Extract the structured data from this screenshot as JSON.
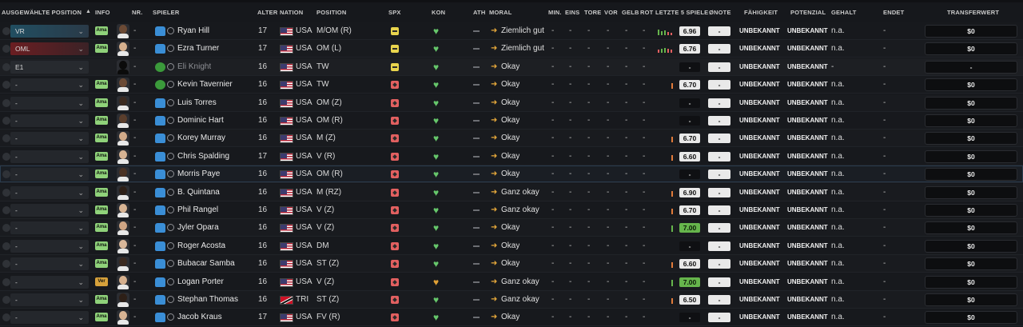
{
  "columns": {
    "position_select": "AUSGEWÄHLTE POSITION",
    "sort_indicator": "▲",
    "info": "INFO",
    "nr": "NR.",
    "player": "SPIELER",
    "age": "ALTER",
    "nation": "NATION",
    "position": "POSITION",
    "spx": "SPX",
    "kon": "KON",
    "ath": "ATH",
    "morale": "MORAL",
    "min": "MIN.",
    "eins": "EINS",
    "tore": "TORE",
    "vor": "VOR",
    "gelb": "GELB",
    "rot": "ROT",
    "last5": "LETZTE 5 SPIELE",
    "avg": "ØNOTE",
    "ability": "FÄHIGKEIT",
    "potential": "POTENZIAL",
    "wage": "GEHALT",
    "ends": "ENDET",
    "value": "TRANSFERWERT"
  },
  "colors": {
    "accent": "#3a8ed6",
    "positive": "#66c76b",
    "warning": "#e0a035",
    "danger": "#e26060"
  },
  "rows": [
    {
      "sel_pos": "VR",
      "sel_style": "vr",
      "info": "Ama",
      "face": "#6b4a35",
      "nr": "-",
      "shirt": "blue",
      "name": "Ryan Hill",
      "age": "17",
      "flag": "usa",
      "nat": "USA",
      "pos": "M/OM (R)",
      "spx": "yellow",
      "kon": "green",
      "ath": "-",
      "morale": "Ziemlich gut",
      "stats": [
        "-",
        "-",
        "-",
        "-",
        "-",
        "-"
      ],
      "form": [
        {
          "h": 7,
          "c": "#66b54c"
        },
        {
          "h": 5,
          "c": "#66b54c"
        },
        {
          "h": 6,
          "c": "#66b54c"
        },
        {
          "h": 4,
          "c": "#e26060"
        },
        {
          "h": 3,
          "c": "#e26060"
        }
      ],
      "rating": "6.96",
      "rating_style": "white",
      "avg": "-",
      "ability": "UNBEKANNT",
      "potential": "UNBEKANNT",
      "wage": "n.a.",
      "ends": "-",
      "value": "$0",
      "style": ""
    },
    {
      "sel_pos": "OML",
      "sel_style": "oml",
      "info": "Ama",
      "face": "#d6b08e",
      "nr": "-",
      "shirt": "blue",
      "name": "Ezra Turner",
      "age": "17",
      "flag": "usa",
      "nat": "USA",
      "pos": "OM (L)",
      "spx": "yellow",
      "kon": "green",
      "ath": "-",
      "morale": "Ziemlich gut",
      "stats": [
        "-",
        "-",
        "-",
        "-",
        "-",
        "-"
      ],
      "form": [
        {
          "h": 4,
          "c": "#e26060"
        },
        {
          "h": 5,
          "c": "#66b54c"
        },
        {
          "h": 6,
          "c": "#66b54c"
        },
        {
          "h": 5,
          "c": "#e26060"
        },
        {
          "h": 4,
          "c": "#e26060"
        }
      ],
      "rating": "6.76",
      "rating_style": "white",
      "avg": "-",
      "ability": "UNBEKANNT",
      "potential": "UNBEKANNT",
      "wage": "n.a.",
      "ends": "-",
      "value": "$0",
      "style": "alt"
    },
    {
      "sel_pos": "E1",
      "sel_style": "e1",
      "info": "",
      "face": "sil",
      "nr": "-",
      "shirt": "green",
      "name": "Eli Knight",
      "age": "16",
      "flag": "usa",
      "nat": "USA",
      "pos": "TW",
      "spx": "yellow",
      "kon": "green",
      "ath": "-",
      "morale": "Okay",
      "stats": [
        "-",
        "-",
        "-",
        "-",
        "-",
        "-"
      ],
      "form": [],
      "rating": "-",
      "rating_style": "blank",
      "avg": "-",
      "ability": "UNBEKANNT",
      "potential": "UNBEKANNT",
      "wage": "-",
      "ends": "-",
      "value": "-",
      "style": "dim"
    },
    {
      "sel_pos": "-",
      "sel_style": "",
      "info": "Ama",
      "face": "#6b4a35",
      "nr": "-",
      "shirt": "green",
      "name": "Kevin Tavernier",
      "age": "16",
      "flag": "usa",
      "nat": "USA",
      "pos": "TW",
      "spx": "red",
      "kon": "green",
      "ath": "-",
      "morale": "Okay",
      "stats": [
        "-",
        "-",
        "-",
        "-",
        "-",
        "-"
      ],
      "form": [
        {
          "h": 7,
          "c": "#e07a3a"
        }
      ],
      "rating": "6.70",
      "rating_style": "white",
      "avg": "-",
      "ability": "UNBEKANNT",
      "potential": "UNBEKANNT",
      "wage": "n.a.",
      "ends": "-",
      "value": "$0",
      "style": ""
    },
    {
      "sel_pos": "-",
      "sel_style": "",
      "info": "Ama",
      "face": "#3b2a20",
      "nr": "-",
      "shirt": "blue",
      "name": "Luis Torres",
      "age": "16",
      "flag": "usa",
      "nat": "USA",
      "pos": "OM (Z)",
      "spx": "red",
      "kon": "green",
      "ath": "-",
      "morale": "Okay",
      "stats": [
        "-",
        "-",
        "-",
        "-",
        "-",
        "-"
      ],
      "form": [],
      "rating": "-",
      "rating_style": "blank",
      "avg": "-",
      "ability": "UNBEKANNT",
      "potential": "UNBEKANNT",
      "wage": "n.a.",
      "ends": "-",
      "value": "$0",
      "style": "alt"
    },
    {
      "sel_pos": "-",
      "sel_style": "",
      "info": "Ama",
      "face": "#5a3e2c",
      "nr": "-",
      "shirt": "blue",
      "name": "Dominic Hart",
      "age": "16",
      "flag": "usa",
      "nat": "USA",
      "pos": "OM (R)",
      "spx": "red",
      "kon": "green",
      "ath": "-",
      "morale": "Okay",
      "stats": [
        "-",
        "-",
        "-",
        "-",
        "-",
        "-"
      ],
      "form": [],
      "rating": "-",
      "rating_style": "blank",
      "avg": "-",
      "ability": "UNBEKANNT",
      "potential": "UNBEKANNT",
      "wage": "n.a.",
      "ends": "-",
      "value": "$0",
      "style": ""
    },
    {
      "sel_pos": "-",
      "sel_style": "",
      "info": "Ama",
      "face": "#d2ab8a",
      "nr": "-",
      "shirt": "blue",
      "name": "Korey Murray",
      "age": "16",
      "flag": "usa",
      "nat": "USA",
      "pos": "M (Z)",
      "spx": "red",
      "kon": "green",
      "ath": "-",
      "morale": "Okay",
      "stats": [
        "-",
        "-",
        "-",
        "-",
        "-",
        "-"
      ],
      "form": [
        {
          "h": 7,
          "c": "#e07a3a"
        }
      ],
      "rating": "6.70",
      "rating_style": "white",
      "avg": "-",
      "ability": "UNBEKANNT",
      "potential": "UNBEKANNT",
      "wage": "n.a.",
      "ends": "-",
      "value": "$0",
      "style": "alt"
    },
    {
      "sel_pos": "-",
      "sel_style": "",
      "info": "Ama",
      "face": "#d8b494",
      "nr": "-",
      "shirt": "blue",
      "name": "Chris Spalding",
      "age": "17",
      "flag": "usa",
      "nat": "USA",
      "pos": "V (R)",
      "spx": "red",
      "kon": "green",
      "ath": "-",
      "morale": "Okay",
      "stats": [
        "-",
        "-",
        "-",
        "-",
        "-",
        "-"
      ],
      "form": [
        {
          "h": 7,
          "c": "#e07a3a"
        }
      ],
      "rating": "6.60",
      "rating_style": "white",
      "avg": "-",
      "ability": "UNBEKANNT",
      "potential": "UNBEKANNT",
      "wage": "n.a.",
      "ends": "-",
      "value": "$0",
      "style": ""
    },
    {
      "sel_pos": "-",
      "sel_style": "",
      "info": "Ama",
      "face": "#4a3224",
      "nr": "-",
      "shirt": "blue",
      "name": "Morris Paye",
      "age": "16",
      "flag": "usa",
      "nat": "USA",
      "pos": "OM (R)",
      "spx": "red",
      "kon": "green",
      "ath": "-",
      "morale": "Okay",
      "stats": [
        "-",
        "-",
        "-",
        "-",
        "-",
        "-"
      ],
      "form": [],
      "rating": "-",
      "rating_style": "blank",
      "avg": "-",
      "ability": "UNBEKANNT",
      "potential": "UNBEKANNT",
      "wage": "n.a.",
      "ends": "-",
      "value": "$0",
      "style": "sel"
    },
    {
      "sel_pos": "-",
      "sel_style": "",
      "info": "Ama",
      "face": "#2d1f17",
      "nr": "-",
      "shirt": "blue",
      "name": "B. Quintana",
      "age": "16",
      "flag": "usa",
      "nat": "USA",
      "pos": "M (RZ)",
      "spx": "red",
      "kon": "green",
      "ath": "-",
      "morale": "Ganz okay",
      "stats": [
        "-",
        "-",
        "-",
        "-",
        "-",
        "-"
      ],
      "form": [
        {
          "h": 7,
          "c": "#e07a3a"
        }
      ],
      "rating": "6.90",
      "rating_style": "white",
      "avg": "-",
      "ability": "UNBEKANNT",
      "potential": "UNBEKANNT",
      "wage": "n.a.",
      "ends": "-",
      "value": "$0",
      "style": "alt"
    },
    {
      "sel_pos": "-",
      "sel_style": "",
      "info": "Ama",
      "face": "#d8b494",
      "nr": "-",
      "shirt": "blue",
      "name": "Phil Rangel",
      "age": "16",
      "flag": "usa",
      "nat": "USA",
      "pos": "V (Z)",
      "spx": "red",
      "kon": "green",
      "ath": "-",
      "morale": "Ganz okay",
      "stats": [
        "-",
        "-",
        "-",
        "-",
        "-",
        "-"
      ],
      "form": [
        {
          "h": 7,
          "c": "#e07a3a"
        }
      ],
      "rating": "6.70",
      "rating_style": "white",
      "avg": "-",
      "ability": "UNBEKANNT",
      "potential": "UNBEKANNT",
      "wage": "n.a.",
      "ends": "-",
      "value": "$0",
      "style": ""
    },
    {
      "sel_pos": "-",
      "sel_style": "",
      "info": "Ama",
      "face": "#cfa584",
      "nr": "-",
      "shirt": "blue",
      "name": "Jyler Opara",
      "age": "16",
      "flag": "usa",
      "nat": "USA",
      "pos": "V (Z)",
      "spx": "red",
      "kon": "green",
      "ath": "-",
      "morale": "Okay",
      "stats": [
        "-",
        "-",
        "-",
        "-",
        "-",
        "-"
      ],
      "form": [
        {
          "h": 8,
          "c": "#66b54c"
        }
      ],
      "rating": "7.00",
      "rating_style": "green",
      "avg": "-",
      "ability": "UNBEKANNT",
      "potential": "UNBEKANNT",
      "wage": "n.a.",
      "ends": "-",
      "value": "$0",
      "style": "alt"
    },
    {
      "sel_pos": "-",
      "sel_style": "",
      "info": "Ama",
      "face": "#d9b79a",
      "nr": "-",
      "shirt": "blue",
      "name": "Roger Acosta",
      "age": "16",
      "flag": "usa",
      "nat": "USA",
      "pos": "DM",
      "spx": "red",
      "kon": "green",
      "ath": "-",
      "morale": "Okay",
      "stats": [
        "-",
        "-",
        "-",
        "-",
        "-",
        "-"
      ],
      "form": [],
      "rating": "-",
      "rating_style": "blank",
      "avg": "-",
      "ability": "UNBEKANNT",
      "potential": "UNBEKANNT",
      "wage": "n.a.",
      "ends": "-",
      "value": "$0",
      "style": ""
    },
    {
      "sel_pos": "-",
      "sel_style": "",
      "info": "Ama",
      "face": "#3b2a20",
      "nr": "-",
      "shirt": "blue",
      "name": "Bubacar Samba",
      "age": "16",
      "flag": "usa",
      "nat": "USA",
      "pos": "ST (Z)",
      "spx": "red",
      "kon": "green",
      "ath": "-",
      "morale": "Okay",
      "stats": [
        "-",
        "-",
        "-",
        "-",
        "-",
        "-"
      ],
      "form": [
        {
          "h": 7,
          "c": "#e07a3a"
        }
      ],
      "rating": "6.60",
      "rating_style": "white",
      "avg": "-",
      "ability": "UNBEKANNT",
      "potential": "UNBEKANNT",
      "wage": "n.a.",
      "ends": "-",
      "value": "$0",
      "style": "alt"
    },
    {
      "sel_pos": "-",
      "sel_style": "",
      "info": "Ver",
      "face": "#d6b08e",
      "nr": "-",
      "shirt": "blue",
      "name": "Logan Porter",
      "age": "16",
      "flag": "usa",
      "nat": "USA",
      "pos": "V (Z)",
      "spx": "red",
      "kon": "orange",
      "ath": "-",
      "morale": "Ganz okay",
      "stats": [
        "-",
        "-",
        "-",
        "-",
        "-",
        "-"
      ],
      "form": [
        {
          "h": 8,
          "c": "#66b54c"
        }
      ],
      "rating": "7.00",
      "rating_style": "green",
      "avg": "-",
      "ability": "UNBEKANNT",
      "potential": "UNBEKANNT",
      "wage": "n.a.",
      "ends": "-",
      "value": "$0",
      "style": ""
    },
    {
      "sel_pos": "-",
      "sel_style": "",
      "info": "Ama",
      "face": "#2d1f17",
      "nr": "-",
      "shirt": "blue",
      "name": "Stephan Thomas",
      "age": "16",
      "flag": "tri",
      "nat": "TRI",
      "pos": "ST (Z)",
      "spx": "red",
      "kon": "green",
      "ath": "-",
      "morale": "Ganz okay",
      "stats": [
        "-",
        "-",
        "-",
        "-",
        "-",
        "-"
      ],
      "form": [
        {
          "h": 7,
          "c": "#e07a3a"
        }
      ],
      "rating": "6.50",
      "rating_style": "white",
      "avg": "-",
      "ability": "UNBEKANNT",
      "potential": "UNBEKANNT",
      "wage": "n.a.",
      "ends": "-",
      "value": "$0",
      "style": "alt"
    },
    {
      "sel_pos": "-",
      "sel_style": "",
      "info": "Ama",
      "face": "#d8b494",
      "nr": "-",
      "shirt": "blue",
      "name": "Jacob Kraus",
      "age": "17",
      "flag": "usa",
      "nat": "USA",
      "pos": "FV (R)",
      "spx": "red",
      "kon": "green",
      "ath": "-",
      "morale": "Okay",
      "stats": [
        "-",
        "-",
        "-",
        "-",
        "-",
        "-"
      ],
      "form": [],
      "rating": "-",
      "rating_style": "blank",
      "avg": "-",
      "ability": "UNBEKANNT",
      "potential": "UNBEKANNT",
      "wage": "n.a.",
      "ends": "-",
      "value": "$0",
      "style": ""
    }
  ]
}
